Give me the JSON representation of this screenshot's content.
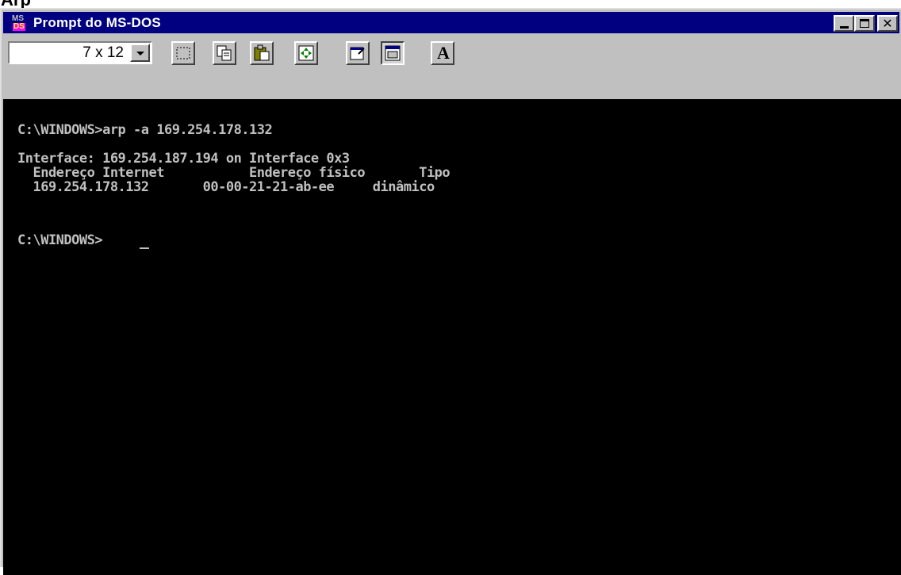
{
  "page_heading": "Arp",
  "window": {
    "title": "Prompt do MS-DOS",
    "icon_text_top": "MS",
    "icon_text_bottom": "DS",
    "buttons": [
      "minimize-icon",
      "maximize-icon",
      "close-icon"
    ]
  },
  "toolbar": {
    "font_size_value": "7 x 12",
    "tools": [
      "mark-icon",
      "copy-icon",
      "paste-icon",
      "fullscreen-icon",
      "properties-icon",
      "background-icon",
      "font-icon"
    ],
    "font_button_label": "A"
  },
  "console": {
    "lines": [
      "C:\\WINDOWS>arp -a 169.254.178.132",
      "",
      "Interface: 169.254.187.194 on Interface 0x3",
      "  Endereço Internet           Endereço físico       Tipo",
      "  169.254.178.132       00-00-21-21-ab-ee     dinâmico",
      "",
      "C:\\WINDOWS>"
    ]
  }
}
